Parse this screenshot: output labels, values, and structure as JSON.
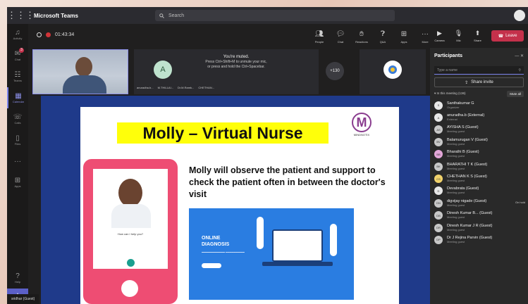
{
  "app": {
    "name": "Microsoft Teams"
  },
  "search": {
    "placeholder": "Search"
  },
  "meeting": {
    "timer": "01:43:34"
  },
  "toolbar": {
    "items": [
      {
        "label": "People",
        "icon": "people-icon"
      },
      {
        "label": "Chat",
        "icon": "chat-icon"
      },
      {
        "label": "Reactions",
        "icon": "reactions-icon"
      },
      {
        "label": "Q&A",
        "icon": "qa-icon"
      },
      {
        "label": "Apps",
        "icon": "apps-icon"
      },
      {
        "label": "More",
        "icon": "more-icon"
      }
    ],
    "camera": "Camera",
    "mic": "Mic",
    "share": "Share",
    "leave": "Leave"
  },
  "rail": [
    {
      "label": "Activity",
      "icon": "bell-icon"
    },
    {
      "label": "Chat",
      "icon": "chat-icon",
      "badge": "3"
    },
    {
      "label": "Teams",
      "icon": "teams-icon"
    },
    {
      "label": "Calendar",
      "icon": "calendar-icon",
      "active": true
    },
    {
      "label": "Calls",
      "icon": "phone-icon"
    },
    {
      "label": "Files",
      "icon": "file-icon"
    },
    {
      "label": "",
      "icon": "more-icon"
    },
    {
      "label": "Apps",
      "icon": "apps-icon"
    }
  ],
  "rail_bottom": {
    "help": "Help"
  },
  "strip": {
    "avatar_letter": "A",
    "muted_title": "You're muted.",
    "muted_line1": "Press Ctrl+Shift+M to unmute your mic,",
    "muted_line2": "or press and hold the Ctrl+Spacebar.",
    "names": [
      "anuradha.b...",
      "M.THILLAI...",
      "Dr.M.Ramk...",
      "CHETHAN..."
    ],
    "overflow": "+130"
  },
  "slide": {
    "title": "Molly – Virtual Nurse",
    "brand": "MINDNOTIX",
    "body": "Molly will observe the patient and support to check the patient often in between the doctor's visit",
    "phone_prompt": "How can I help you?",
    "diag_title_1": "ONLINE",
    "diag_title_2": "DIAGNOSIS"
  },
  "presenter": "sridhar (Guest)",
  "panel": {
    "title": "Participants",
    "search_placeholder": "Type a name",
    "share_invite": "Share invite",
    "in_meeting": "In this meeting (136)",
    "mute_all": "Mute all",
    "participants": [
      {
        "initials": "S",
        "name": "Santhakumar G",
        "role": "Organizer",
        "color": "#e8e8e8"
      },
      {
        "initials": "A",
        "name": "anuradha.b (External)",
        "role": "External",
        "color": "#e8e8e8"
      },
      {
        "initials": "AS",
        "name": "AYISHA S (Guest)",
        "role": "Meeting guest",
        "color": "#c8c8c8"
      },
      {
        "initials": "BV",
        "name": "Balamurugan V (Guest)",
        "role": "Meeting guest",
        "color": "#c8c8c8"
      },
      {
        "initials": "BB",
        "name": "Bharathi B (Guest)",
        "role": "Meeting guest",
        "color": "#e3a6d8"
      },
      {
        "initials": "BK",
        "name": "BHARATHI T K (Guest)",
        "role": "Meeting guest",
        "color": "#c8c8c8"
      },
      {
        "initials": "CS",
        "name": "CHETHAN K S (Guest)",
        "role": "Meeting guest",
        "color": "#f2d36b"
      },
      {
        "initials": "D",
        "name": "Devabrata (Guest)",
        "role": "Meeting guest",
        "color": "#e8e8e8"
      },
      {
        "initials": "DN",
        "name": "digvijay nigade (Guest)",
        "role": "Meeting guest",
        "color": "#c8c8c8",
        "extra": "On hold"
      },
      {
        "initials": "DB",
        "name": "Dinesh Kumar B... (Guest)",
        "role": "Meeting guest",
        "color": "#c8c8c8"
      },
      {
        "initials": "DR",
        "name": "Dinesh Kumar J R (Guest)",
        "role": "Meeting guest",
        "color": "#c8c8c8"
      },
      {
        "initials": "DP",
        "name": "Dr J Rejina Parvin (Guest)",
        "role": "Meeting guest",
        "color": "#c8c8c8"
      }
    ]
  }
}
